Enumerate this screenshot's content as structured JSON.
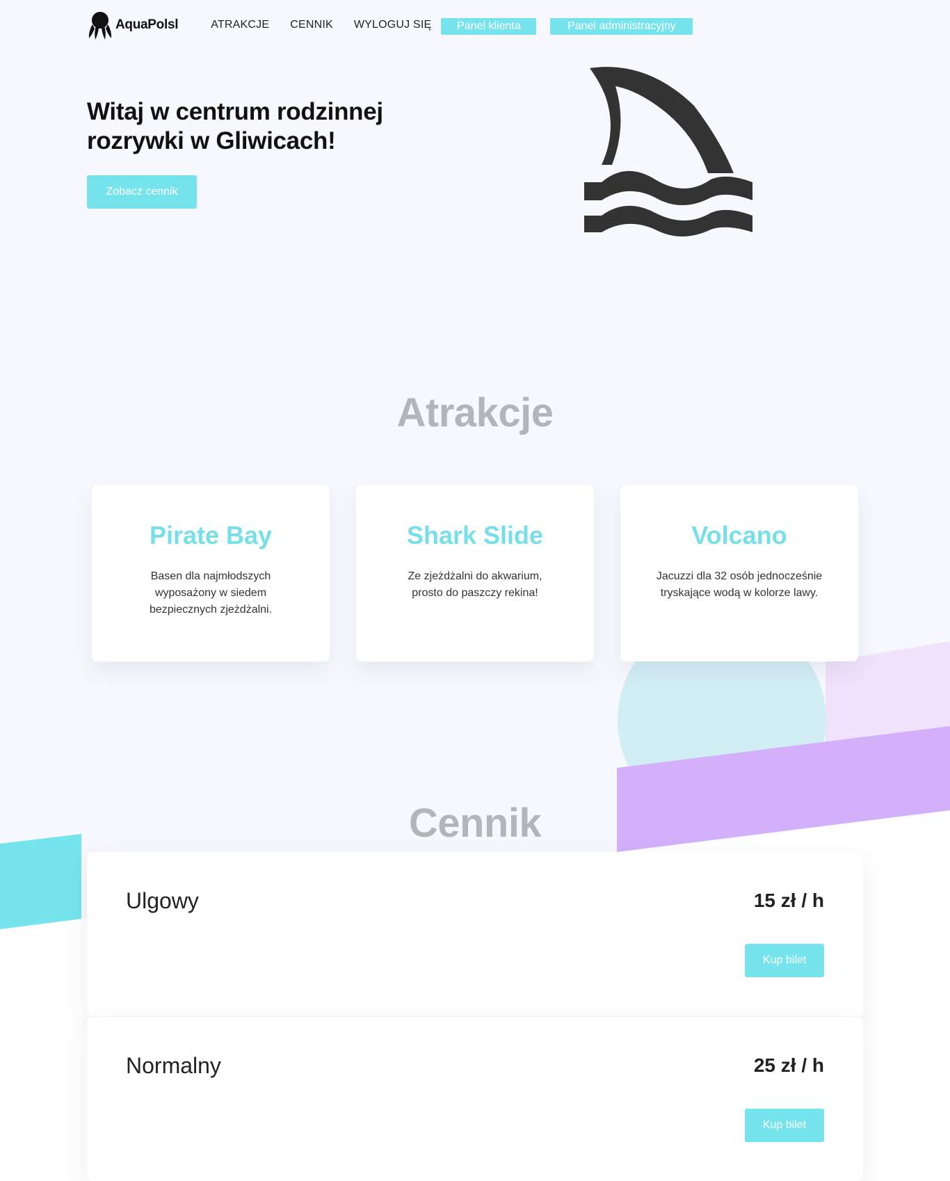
{
  "brand": {
    "name": "AquaPolsl",
    "logo_icon": "octopus-icon"
  },
  "nav": {
    "links": [
      "ATRAKCJE",
      "CENNIK",
      "WYLOGUJ SIĘ"
    ],
    "client_panel": "Panel klienta",
    "admin_panel": "Panel administracyjny"
  },
  "hero": {
    "title": "Witaj w centrum rodzinnej rozrywki w Gliwicach!",
    "cta": "Zobacz cennik",
    "illustration_icon": "shark-fin-icon"
  },
  "attractions": {
    "title": "Atrakcje",
    "items": [
      {
        "name": "Pirate Bay",
        "description": "Basen dla najmłodszych wyposażony w siedem bezpiecznych zjeżdżalni."
      },
      {
        "name": "Shark Slide",
        "description": "Ze zjeżdżalni do akwarium, prosto do paszczy rekina!"
      },
      {
        "name": "Volcano",
        "description": "Jacuzzi dla 32 osób jednocześnie tryskające wodą w kolorze lawy."
      }
    ]
  },
  "pricing": {
    "title": "Cennik",
    "tickets": [
      {
        "name": "Ulgowy",
        "price": "15 zł / h",
        "button": "Kup bilet"
      },
      {
        "name": "Normalny",
        "price": "25 zł / h",
        "button": "Kup bilet"
      }
    ]
  },
  "colors": {
    "accent": "#76e4ec",
    "background": "#f6f8fd",
    "section_title": "#b4b5b9",
    "decor_light_cyan": "#d2eef5",
    "decor_light_purple": "#f1e2fb",
    "decor_purple": "#d4b0fb"
  }
}
